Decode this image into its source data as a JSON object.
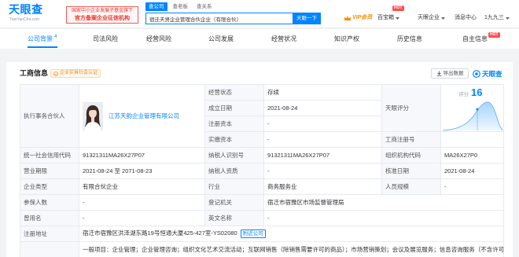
{
  "colors": {
    "primary": "#0084ff",
    "hot": "#ff4d4f",
    "vip": "#ff8a00",
    "label_bg": "#f6f8fb",
    "border": "#e6ebf1"
  },
  "icons": {
    "vip": "crown-icon",
    "dropdown": "caret-down-icon",
    "export": "download-icon",
    "brand": "eye-icon",
    "cert": "smile-badge-icon",
    "avatar": "person-photo"
  },
  "header": {
    "logo_text": "天眼查",
    "logo_sub": "TianYanCha.com",
    "banner_line1": "国家中小企业发展子基金旗下",
    "banner_line2": "官方备案企业征信机构",
    "search_tabs": [
      "查公司",
      "查老板",
      "查关系"
    ],
    "search_value": "宿迁天贤企业管理合伙企业（有限合伙）",
    "search_button": "天眼一下",
    "vip_label": "VIP会员",
    "baibaoxiang_label": "百宝箱",
    "enterprise_label": "天眼企业",
    "message_label": "消息中心",
    "user_label": "1九九三"
  },
  "badges": {
    "hot": "HOT"
  },
  "nav": {
    "tabs": [
      {
        "label": "公司背景",
        "count": "4"
      },
      {
        "label": "司法风险"
      },
      {
        "label": "经营风险"
      },
      {
        "label": "公司发展"
      },
      {
        "label": "经营状况"
      },
      {
        "label": "知识产权"
      },
      {
        "label": "历史信息"
      },
      {
        "label": "自主信息"
      }
    ]
  },
  "section": {
    "title": "工商信息",
    "cert_badge": "企业实景社会认证",
    "export_label": "导出数据",
    "brand_label": "天眼查"
  },
  "info": {
    "partner_label": "执行事务合伙人",
    "partner_name": "江苏天韵企业管理有限公司",
    "status_label": "经营状态",
    "status": "存续",
    "score_label": "天眼评分",
    "score_caption": "评分",
    "score_value": "16",
    "founded_label": "成立日期",
    "founded": "2021-08-24",
    "reg_capital_label": "注册资本",
    "reg_capital": "-",
    "paid_capital_label": "实缴资本",
    "paid_capital": "-",
    "reg_no_label": "工商注册号",
    "credit_code_label": "统一社会信用代码",
    "credit_code": "91321311MA26X27P07",
    "tax_id_label": "纳税人识别号",
    "tax_id": "91321311MA26X27P07",
    "org_code_label": "组织机构代码",
    "org_code": "MA26X27P0",
    "term_label": "营业期限",
    "term": "2021-08-24 至 2071-08-23",
    "taxpayer_qual_label": "纳税人资质",
    "taxpayer_qual": "-",
    "approved_label": "核准日期",
    "approved": "2021-08-24",
    "type_label": "企业类型",
    "type": "有限合伙企业",
    "industry_label": "行业",
    "industry": "商务服务业",
    "staff_label": "人员规模",
    "staff": "-",
    "insured_label": "参保人数",
    "insured": "-",
    "authority_label": "登记机关",
    "authority": "宿迁市宿豫区市场监督管理局",
    "former_name_label": "曾用名",
    "former_name": "-",
    "english_name_label": "英文名称",
    "english_name": "-",
    "address_label": "注册地址",
    "address": "宿迁市宿豫区洪泽湖东路19号恒通大厦425-427室-YS02080",
    "nearby_label": "附近公司",
    "scope": "一般项目：企业管理；企业管理咨询；组织文化艺术交流活动；互联网销售（除销售需要许可的商品）；市场营销策划；会议及展览服务；信息咨询服务（不含许可类信息咨询服务）；文艺创作；专业设计服务；"
  }
}
